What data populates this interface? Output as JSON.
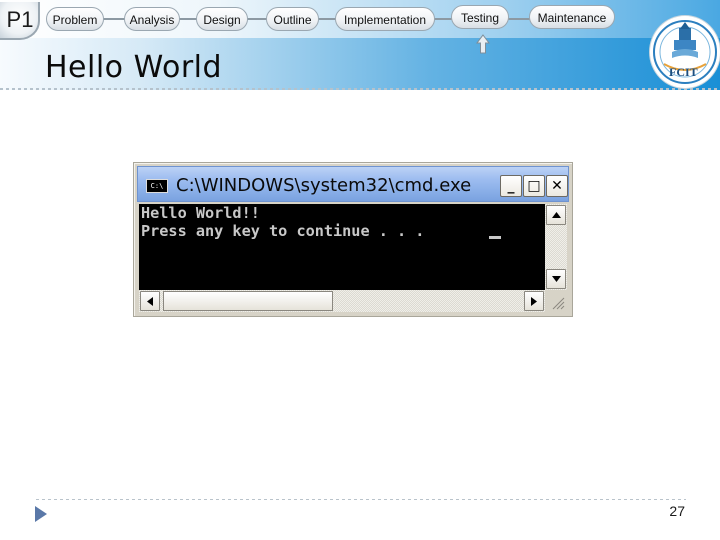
{
  "header": {
    "badge": "P1",
    "title": "Hello World",
    "steps": [
      {
        "label": "Problem"
      },
      {
        "label": "Analysis"
      },
      {
        "label": "Design"
      },
      {
        "label": "Outline"
      },
      {
        "label": "Implementation"
      },
      {
        "label": "Testing"
      },
      {
        "label": "Maintenance"
      }
    ],
    "logo_text": "FCIT",
    "current_step": "Testing"
  },
  "console": {
    "window_title": "C:\\WINDOWS\\system32\\cmd.exe",
    "icon_label": "C:\\",
    "buttons": {
      "minimize": "_",
      "maximize": "□",
      "close": "✕"
    },
    "lines": [
      "Hello World!!",
      "Press any key to continue . . . "
    ]
  },
  "footer": {
    "page_number": "27"
  },
  "colors": {
    "header_accent": "#1a8fd6",
    "console_bg": "#000000",
    "console_text": "#c8c8c8",
    "titlebar": "#9ebdf0"
  }
}
